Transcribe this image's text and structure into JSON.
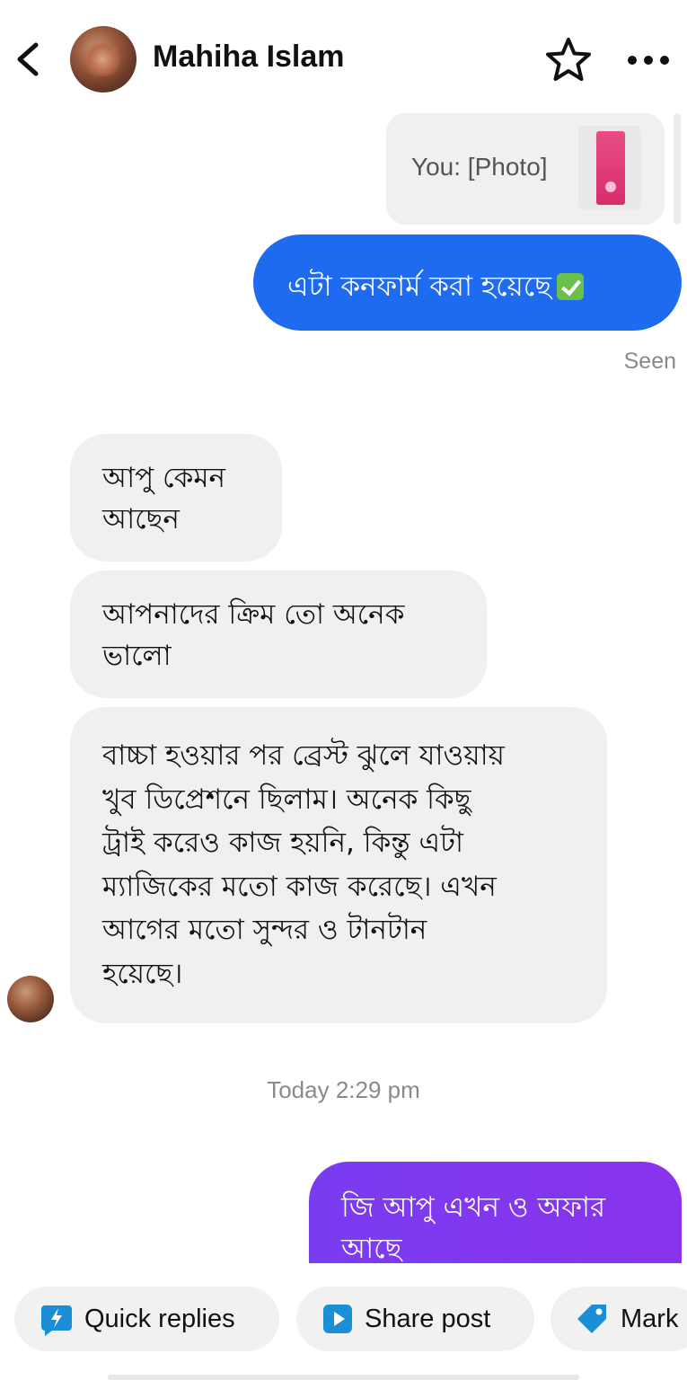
{
  "header": {
    "contact_name": "Mahiha Islam",
    "icons": [
      "back-arrow-icon",
      "star-icon",
      "more-icon"
    ]
  },
  "messages": [
    {
      "direction": "outgoing",
      "type": "photo",
      "text": "You: [Photo]"
    },
    {
      "direction": "outgoing",
      "type": "text",
      "text": "এটা কনফার্ম করা হয়েছে",
      "emoji": "check-mark-icon",
      "color": "#1f6bf0"
    },
    {
      "status": "Seen"
    },
    {
      "direction": "incoming",
      "type": "text",
      "lines": [
        "আপু কেমন",
        "আছেন"
      ]
    },
    {
      "direction": "incoming",
      "type": "text",
      "lines": [
        "আপনাদের ক্রিম তো অনেক",
        "ভালো"
      ]
    },
    {
      "direction": "incoming",
      "type": "text",
      "lines": [
        "বাচ্চা হওয়ার পর ব্রেস্ট ঝুলে যাওয়ায়",
        "খুব ডিপ্রেশনে ছিলাম। অনেক কিছু",
        "ট্রাই করেও কাজ হয়নি, কিন্তু এটা",
        "ম্যাজিকের মতো কাজ করেছে। এখন",
        "আগের মতো সুন্দর ও টানটান",
        "হয়েছে।"
      ]
    },
    {
      "timestamp": "Today 2:29 pm"
    },
    {
      "direction": "outgoing",
      "type": "text",
      "lines": [
        "জি আপু এখন ও অফার",
        "আছে"
      ],
      "color": "#7a3cf0"
    }
  ],
  "quick_actions": [
    {
      "label": "Quick replies",
      "icon": "lightning-chat-icon",
      "color": "#1a8fd8"
    },
    {
      "label": "Share post",
      "icon": "play-square-icon",
      "color": "#1a8fd8"
    },
    {
      "label": "Mark",
      "icon": "tag-icon",
      "color": "#1a8fd8"
    }
  ]
}
